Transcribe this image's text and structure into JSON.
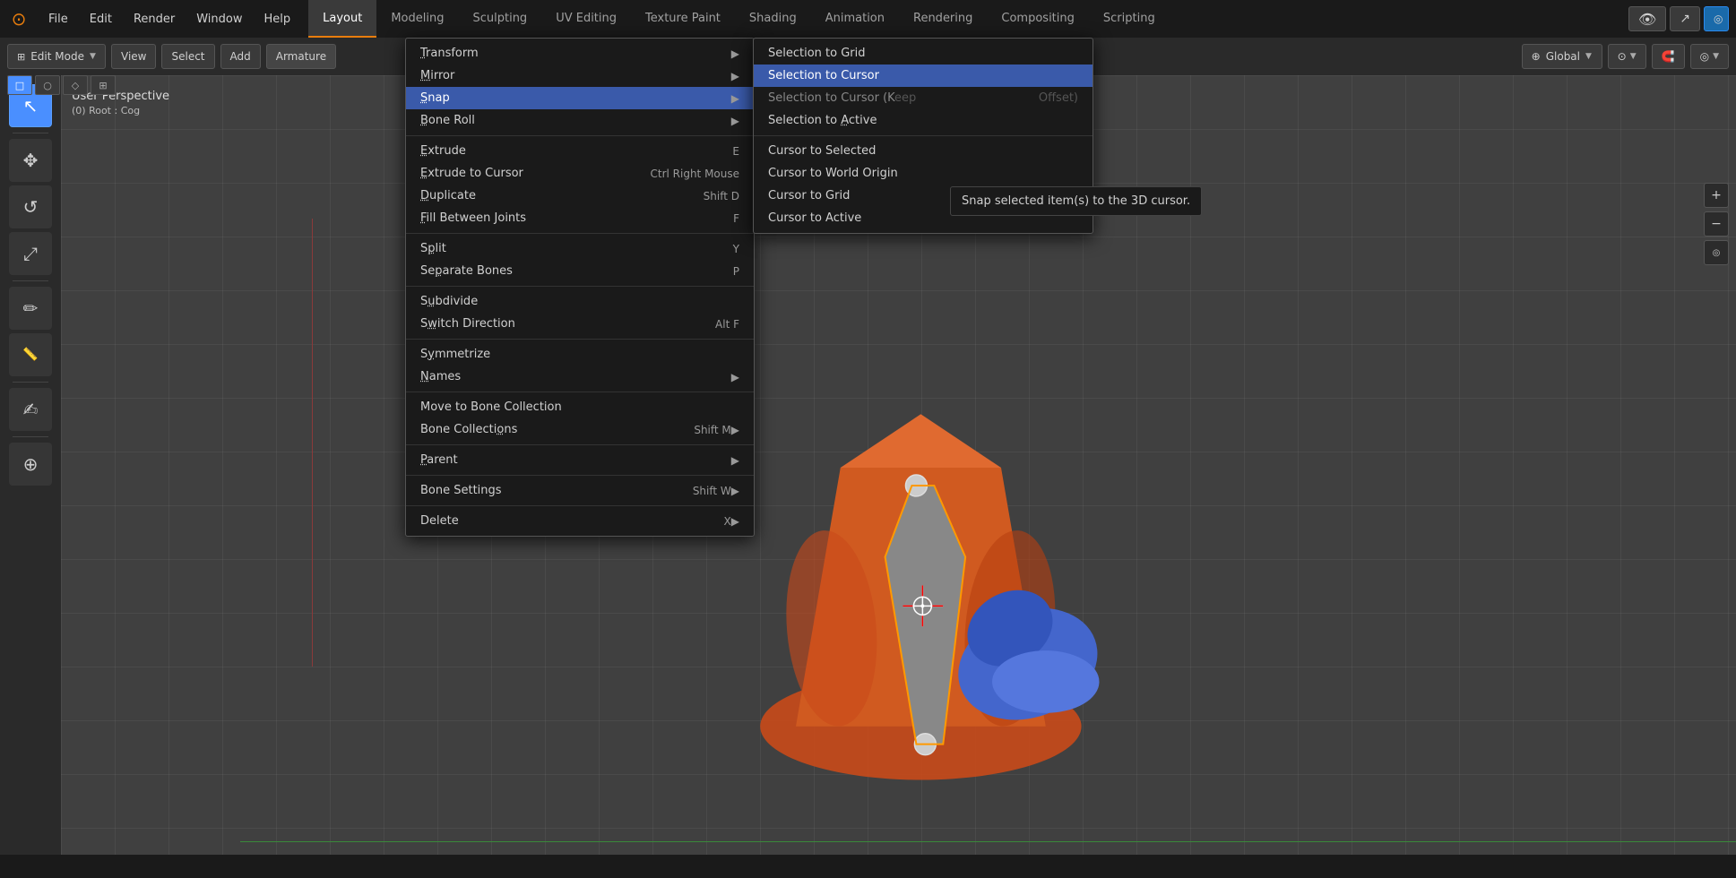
{
  "app": {
    "logo": "⊙",
    "title": "Blender"
  },
  "top_menu": {
    "items": [
      {
        "id": "file",
        "label": "File"
      },
      {
        "id": "edit",
        "label": "Edit"
      },
      {
        "id": "render",
        "label": "Render"
      },
      {
        "id": "window",
        "label": "Window"
      },
      {
        "id": "help",
        "label": "Help"
      }
    ]
  },
  "workspace_tabs": [
    {
      "id": "layout",
      "label": "Layout",
      "active": true
    },
    {
      "id": "modeling",
      "label": "Modeling"
    },
    {
      "id": "sculpting",
      "label": "Sculpting"
    },
    {
      "id": "uv_editing",
      "label": "UV Editing"
    },
    {
      "id": "texture_paint",
      "label": "Texture Paint"
    },
    {
      "id": "shading",
      "label": "Shading"
    },
    {
      "id": "animation",
      "label": "Animation"
    },
    {
      "id": "rendering",
      "label": "Rendering"
    },
    {
      "id": "compositing",
      "label": "Compositing"
    },
    {
      "id": "scripting",
      "label": "Scripting"
    }
  ],
  "second_toolbar": {
    "mode_selector": "Edit Mode",
    "view_btn": "View",
    "select_btn": "Select",
    "add_btn": "Add",
    "armature_btn": "Armature",
    "transform_selector": "Global",
    "icons": [
      "⊙",
      "⟳",
      "◎",
      "∧"
    ]
  },
  "select_modes": [
    {
      "id": "box",
      "icon": "□",
      "active": true
    },
    {
      "id": "circle",
      "icon": "○"
    },
    {
      "id": "lasso",
      "icon": "◇"
    },
    {
      "id": "other",
      "icon": "⊞"
    }
  ],
  "tools": [
    {
      "id": "select",
      "icon": "↖",
      "active": true
    },
    {
      "id": "move",
      "icon": "✥"
    },
    {
      "id": "rotate",
      "icon": "↺"
    },
    {
      "id": "scale",
      "icon": "⤢"
    },
    {
      "id": "pen",
      "icon": "✏"
    },
    {
      "id": "ruler",
      "icon": "📏"
    },
    {
      "id": "annotate",
      "icon": "✍"
    },
    {
      "id": "cursor",
      "icon": "⊕"
    }
  ],
  "viewport": {
    "mode_label": "User Perspective",
    "object_label": "(0) Root : Cog"
  },
  "armature_menu": {
    "items": [
      {
        "id": "transform",
        "label": "Transform",
        "has_submenu": true,
        "shortcut": ""
      },
      {
        "id": "mirror",
        "label": "Mirror",
        "has_submenu": true,
        "shortcut": ""
      },
      {
        "id": "snap",
        "label": "Snap",
        "has_submenu": true,
        "shortcut": "",
        "highlighted": true
      },
      {
        "id": "bone_roll",
        "label": "Bone Roll",
        "has_submenu": true,
        "shortcut": ""
      },
      {
        "id": "sep1",
        "type": "separator"
      },
      {
        "id": "extrude",
        "label": "Extrude",
        "shortcut": "E"
      },
      {
        "id": "extrude_cursor",
        "label": "Extrude to Cursor",
        "shortcut": "Ctrl Right Mouse"
      },
      {
        "id": "duplicate",
        "label": "Duplicate",
        "shortcut": "Shift D"
      },
      {
        "id": "fill_between",
        "label": "Fill Between Joints",
        "shortcut": "F"
      },
      {
        "id": "sep2",
        "type": "separator"
      },
      {
        "id": "split",
        "label": "Split",
        "shortcut": "Y"
      },
      {
        "id": "separate_bones",
        "label": "Separate Bones",
        "shortcut": "P"
      },
      {
        "id": "sep3",
        "type": "separator"
      },
      {
        "id": "subdivide",
        "label": "Subdivide",
        "shortcut": ""
      },
      {
        "id": "switch_direction",
        "label": "Switch Direction",
        "shortcut": "Alt F"
      },
      {
        "id": "sep4",
        "type": "separator"
      },
      {
        "id": "symmetrize",
        "label": "Symmetrize",
        "shortcut": ""
      },
      {
        "id": "names",
        "label": "Names",
        "has_submenu": true,
        "shortcut": ""
      },
      {
        "id": "sep5",
        "type": "separator"
      },
      {
        "id": "move_to_bone_coll",
        "label": "Move to Bone Collection",
        "shortcut": ""
      },
      {
        "id": "bone_collections",
        "label": "Bone Collections",
        "shortcut": "Shift M",
        "has_submenu": true
      },
      {
        "id": "sep6",
        "type": "separator"
      },
      {
        "id": "parent",
        "label": "Parent",
        "has_submenu": true,
        "shortcut": ""
      },
      {
        "id": "sep7",
        "type": "separator"
      },
      {
        "id": "bone_settings",
        "label": "Bone Settings",
        "shortcut": "Shift W",
        "has_submenu": true
      },
      {
        "id": "sep8",
        "type": "separator"
      },
      {
        "id": "delete",
        "label": "Delete",
        "shortcut": "X",
        "has_submenu": true
      }
    ]
  },
  "snap_submenu": {
    "items": [
      {
        "id": "sel_to_grid",
        "label": "Selection to Grid",
        "shortcut": ""
      },
      {
        "id": "sel_to_cursor",
        "label": "Selection to Cursor",
        "shortcut": "",
        "highlighted": true
      },
      {
        "id": "sel_to_cursor_offset",
        "label": "Selection to Cursor (Keep Offset)",
        "shortcut": ""
      },
      {
        "id": "sel_to_active",
        "label": "Selection to Active",
        "shortcut": ""
      },
      {
        "id": "sep1",
        "type": "separator"
      },
      {
        "id": "cursor_to_selected",
        "label": "Cursor to Selected",
        "shortcut": ""
      },
      {
        "id": "cursor_to_world_origin",
        "label": "Cursor to World Origin",
        "shortcut": ""
      },
      {
        "id": "cursor_to_grid",
        "label": "Cursor to Grid",
        "shortcut": ""
      },
      {
        "id": "cursor_to_active",
        "label": "Cursor to Active",
        "shortcut": ""
      }
    ]
  },
  "tooltip": {
    "text": "Snap selected item(s) to the 3D cursor."
  },
  "status_bar": {
    "text": ""
  }
}
